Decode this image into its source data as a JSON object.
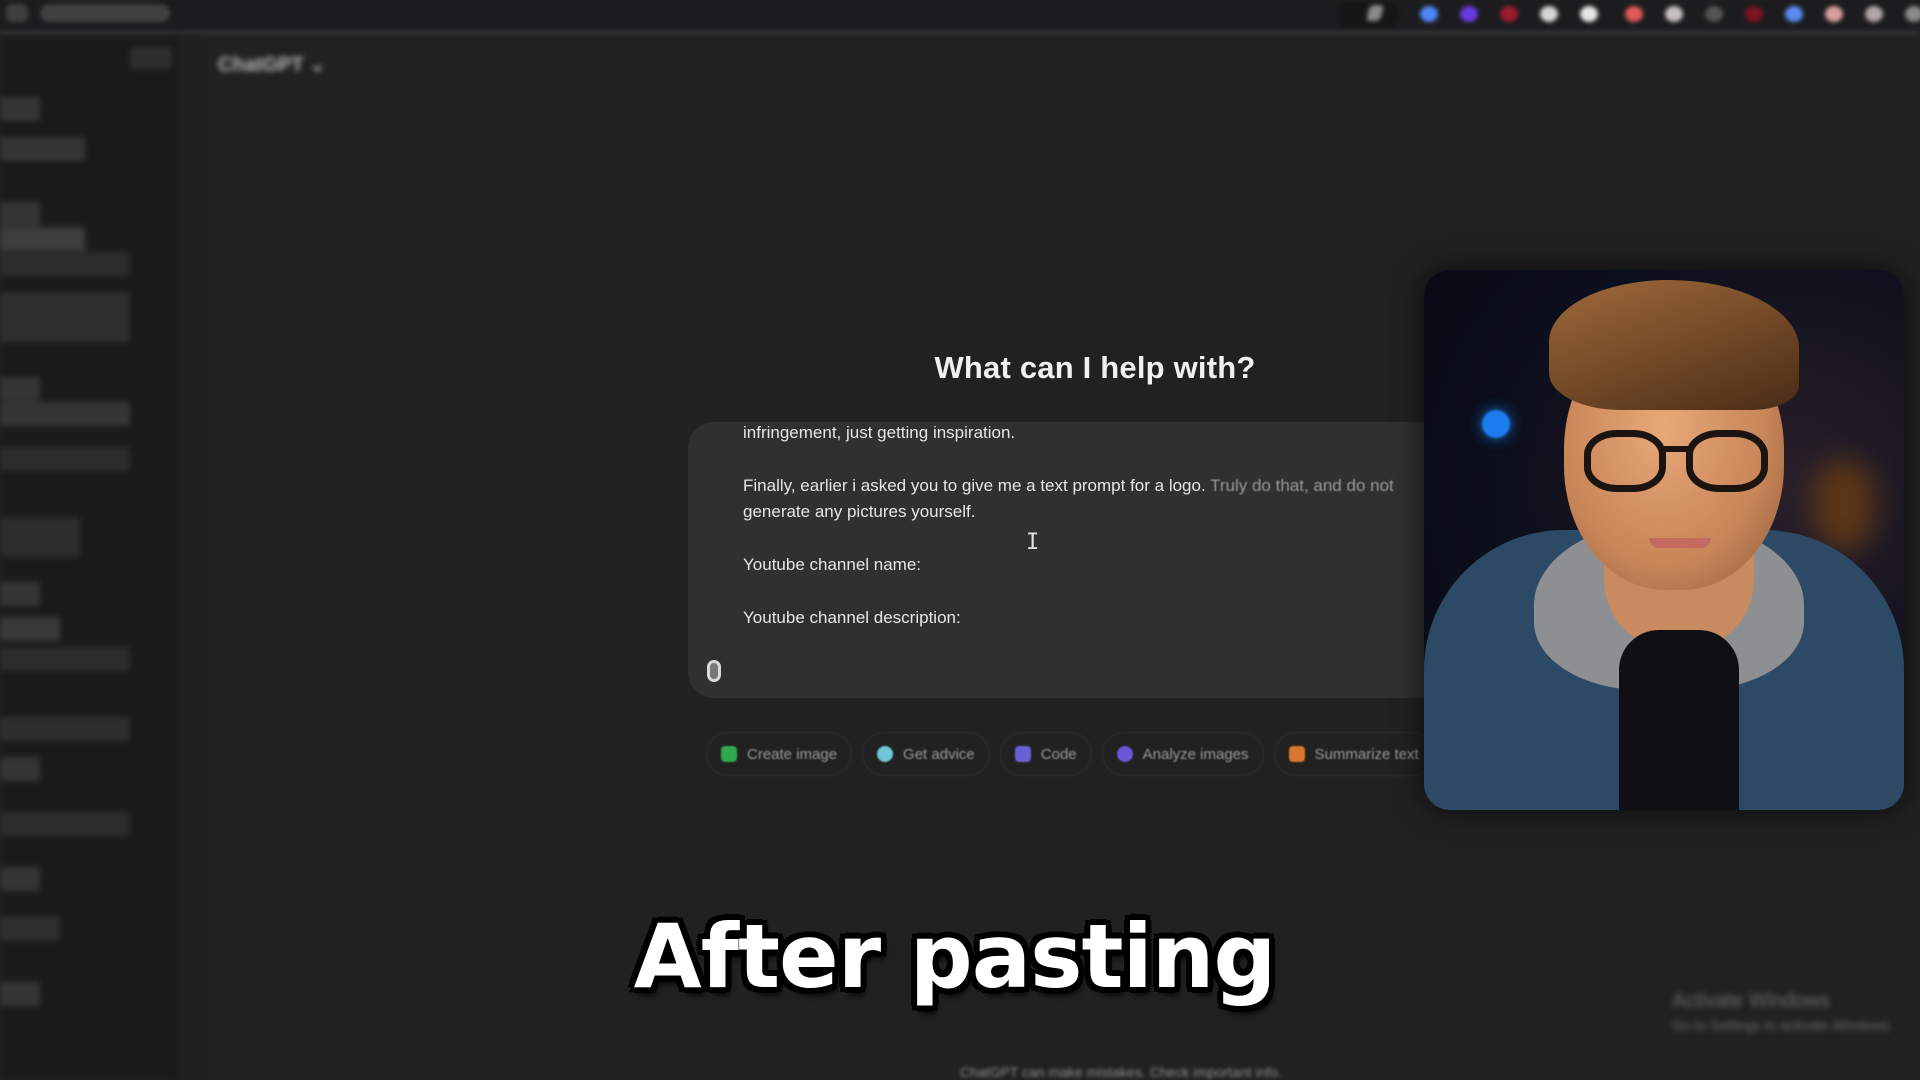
{
  "browser": {
    "extensions": [
      {
        "name": "blue-extension",
        "color": "#4f86f7"
      },
      {
        "name": "purple-extension",
        "color": "#6a3be0"
      },
      {
        "name": "red-extension",
        "color": "#9b1c2c"
      },
      {
        "name": "white-extension",
        "color": "#d6d6d6"
      },
      {
        "name": "white-extension-2",
        "color": "#e6e6e6"
      },
      {
        "name": "red-pink-extension",
        "color": "#e05a5a"
      },
      {
        "name": "white-red-extension",
        "color": "#c8c0c0"
      },
      {
        "name": "gray-extension",
        "color": "#555555"
      },
      {
        "name": "dark-red-extension",
        "color": "#7a1420"
      },
      {
        "name": "blue-extension-2",
        "color": "#5a8cf0"
      },
      {
        "name": "pink-extension",
        "color": "#d8a0a0"
      },
      {
        "name": "profile-extension",
        "color": "#b0a8a8"
      },
      {
        "name": "gray-extension-2",
        "color": "#8a8a8a"
      }
    ]
  },
  "header": {
    "model_selector": "ChatGPT ⌄"
  },
  "main": {
    "heading": "What can I help with?",
    "composer": {
      "lines": [
        {
          "text": "infringement, just getting inspiration.",
          "faded_tail": ""
        },
        {
          "text": "",
          "faded_tail": ""
        },
        {
          "text": "Finally, earlier i asked you to give me a text prompt for a logo. ",
          "faded_tail": "Truly do that, and do not"
        },
        {
          "text": "generate any pictures yourself.",
          "faded_tail": ""
        },
        {
          "text": "",
          "faded_tail": ""
        },
        {
          "text": "Youtube channel name:",
          "faded_tail": ""
        },
        {
          "text": "",
          "faded_tail": ""
        },
        {
          "text": "Youtube channel description:",
          "faded_tail": ""
        }
      ],
      "attach_icon": "paperclip-icon"
    },
    "chips": [
      {
        "label": "Create image",
        "icon": "create-image-icon",
        "color": "#2fa84f"
      },
      {
        "label": "Get advice",
        "icon": "graduation-cap-icon",
        "color": "#6ec7d6"
      },
      {
        "label": "Code",
        "icon": "code-icon",
        "color": "#6b5fd6"
      },
      {
        "label": "Analyze images",
        "icon": "eye-icon",
        "color": "#6a58d8"
      },
      {
        "label": "Summarize text",
        "icon": "document-icon",
        "color": "#d9772f"
      }
    ],
    "footer_note": "ChatGPT can make mistakes. Check important info."
  },
  "overlay": {
    "caption": "After pasting",
    "watermark_title": "Activate Windows",
    "watermark_sub": "Go to Settings to activate Windows."
  }
}
